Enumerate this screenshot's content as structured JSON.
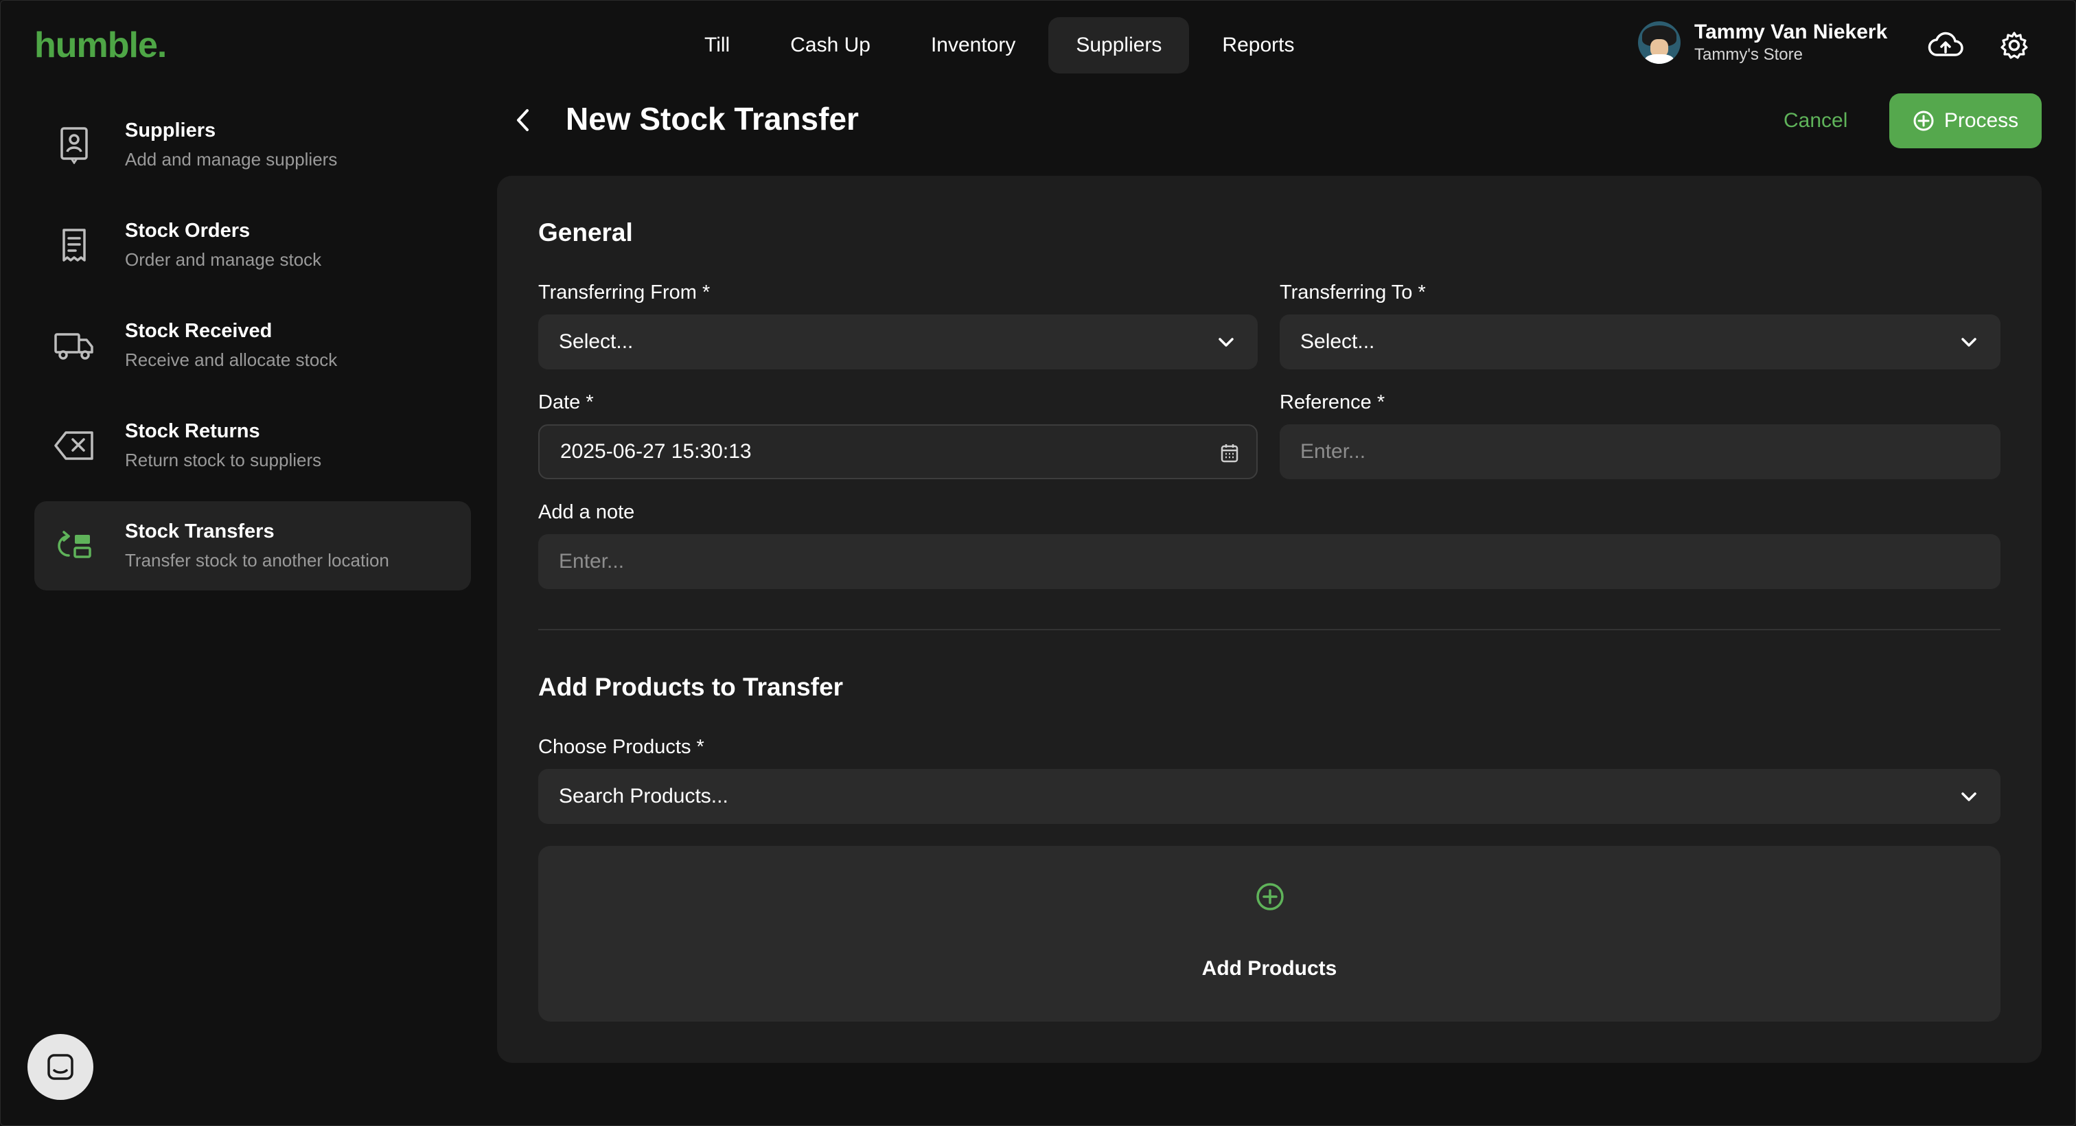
{
  "app": {
    "logo": "humble."
  },
  "topnav": {
    "tabs": [
      {
        "label": "Till"
      },
      {
        "label": "Cash Up"
      },
      {
        "label": "Inventory"
      },
      {
        "label": "Suppliers",
        "active": true
      },
      {
        "label": "Reports"
      }
    ]
  },
  "user": {
    "name": "Tammy Van Niekerk",
    "store": "Tammy's Store"
  },
  "icons": {
    "upload": "cloud-upload-icon",
    "settings": "gear-icon"
  },
  "sidebar": {
    "items": [
      {
        "title": "Suppliers",
        "desc": "Add and manage suppliers",
        "icon": "supplier-badge-icon"
      },
      {
        "title": "Stock Orders",
        "desc": "Order and manage stock",
        "icon": "receipt-icon"
      },
      {
        "title": "Stock Received",
        "desc": "Receive and allocate stock",
        "icon": "truck-icon"
      },
      {
        "title": "Stock Returns",
        "desc": "Return stock to suppliers",
        "icon": "return-icon"
      },
      {
        "title": "Stock Transfers",
        "desc": "Transfer stock to another location",
        "icon": "transfer-icon",
        "active": true
      }
    ]
  },
  "header": {
    "title": "New Stock Transfer",
    "cancel": "Cancel",
    "process": "Process"
  },
  "general": {
    "heading": "General",
    "from_label": "Transferring From *",
    "from_value": "Select...",
    "to_label": "Transferring To *",
    "to_value": "Select...",
    "date_label": "Date *",
    "date_value": "2025-06-27 15:30:13",
    "reference_label": "Reference *",
    "reference_placeholder": "Enter...",
    "note_label": "Add a note",
    "note_placeholder": "Enter..."
  },
  "products": {
    "heading": "Add Products to Transfer",
    "choose_label": "Choose Products *",
    "search_placeholder": "Search Products...",
    "add_label": "Add Products"
  },
  "colors": {
    "accent": "#55a84d",
    "background": "#111111",
    "panel": "#1e1e1e",
    "field": "#2b2b2b"
  }
}
